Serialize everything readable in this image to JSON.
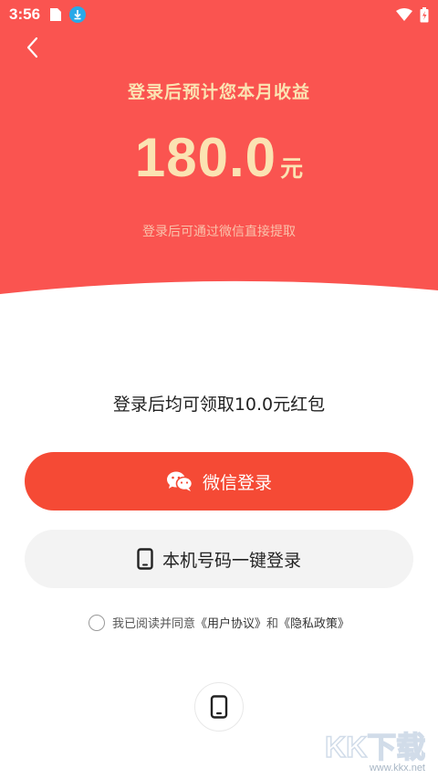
{
  "status_bar": {
    "time": "3:56",
    "icons": [
      "sim-icon",
      "download-icon",
      "wifi-icon",
      "battery-icon"
    ]
  },
  "header": {
    "back_icon": "chevron-left-icon",
    "title": "登录后预计您本月收益",
    "amount": "180.0",
    "unit": "元",
    "subtitle": "登录后可通过微信直接提取"
  },
  "promo": {
    "text": "登录后均可领取10.0元红包"
  },
  "buttons": {
    "wechat_label": "微信登录",
    "wechat_icon": "wechat-icon",
    "phone_label": "本机号码一键登录",
    "phone_icon": "phone-icon",
    "other_icon": "phone-icon"
  },
  "agreement": {
    "prefix": "我已阅读并同意",
    "user_agreement": "《用户协议》",
    "and": "和",
    "privacy_policy": "《隐私政策》"
  },
  "watermark": {
    "text": "KK下载",
    "url": "www.kkx.net"
  },
  "colors": {
    "hero_bg": "#fa5450",
    "hero_text": "#fbe3b2",
    "primary_button": "#f54a35",
    "secondary_button": "#f3f3f3"
  }
}
